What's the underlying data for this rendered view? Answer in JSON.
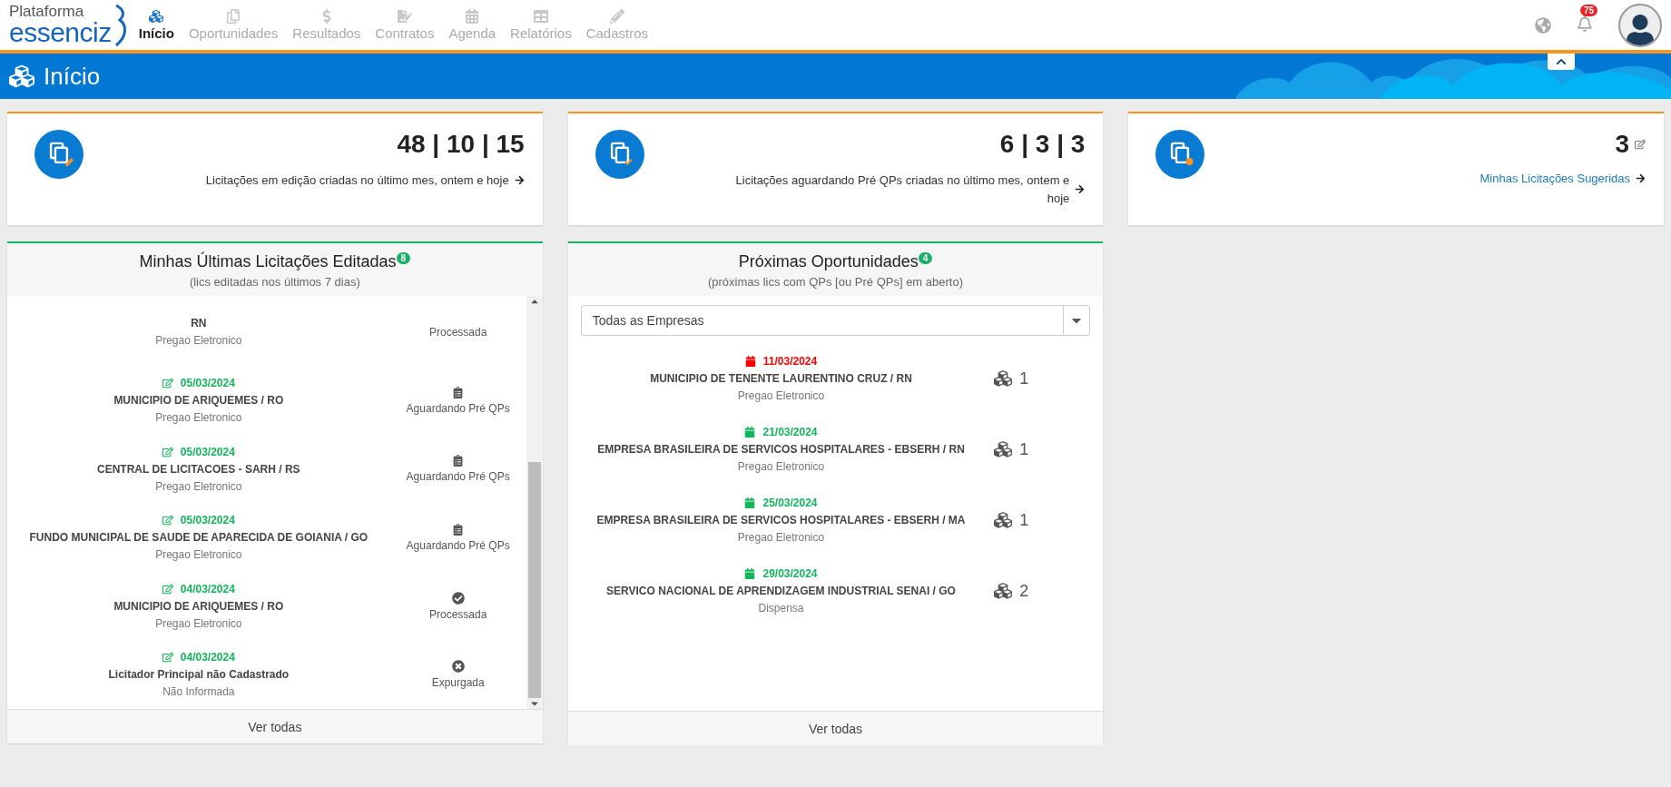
{
  "logo": {
    "top": "Plataforma",
    "bottom": "essenciz"
  },
  "nav": [
    {
      "label": "Início",
      "kind": "cubes",
      "selected": true
    },
    {
      "label": "Oportunidades",
      "kind": "copy",
      "selected": false
    },
    {
      "label": "Resultados",
      "kind": "dollar",
      "selected": false
    },
    {
      "label": "Contratos",
      "kind": "contract",
      "selected": false
    },
    {
      "label": "Agenda",
      "kind": "calendar",
      "selected": false
    },
    {
      "label": "Relatórios",
      "kind": "table",
      "selected": false
    },
    {
      "label": "Cadastros",
      "kind": "pencil",
      "selected": false
    }
  ],
  "notifications": {
    "count": "75"
  },
  "page_title": "Início",
  "stats": [
    {
      "kind": "edit",
      "value": "48 | 10 | 15",
      "text": "Licitações em edição criadas no último mes, ontem e hoje"
    },
    {
      "kind": "check",
      "value": "6 | 3 | 3",
      "text": "Licitações aguardando Pré QPs criadas no último mes, ontem e hoje"
    },
    {
      "kind": "bulb",
      "value": "3",
      "link": "Minhas Licitações Sugeridas"
    }
  ],
  "recent": {
    "title": "Minhas Últimas Licitações Editadas",
    "count": "8",
    "subtitle": "(lics editadas nos últimos 7 dias)",
    "items": [
      {
        "org": "RN",
        "modality": "Pregao Eletronico",
        "status": "Processada",
        "kind": "none"
      },
      {
        "date": "05/03/2024",
        "org": "MUNICIPIO DE ARIQUEMES / RO",
        "modality": "Pregao Eletronico",
        "status": "Aguardando Pré QPs",
        "kind": "pending"
      },
      {
        "date": "05/03/2024",
        "org": "CENTRAL DE LICITACOES - SARH / RS",
        "modality": "Pregao Eletronico",
        "status": "Aguardando Pré QPs",
        "kind": "pending"
      },
      {
        "date": "05/03/2024",
        "org": "FUNDO MUNICIPAL DE SAUDE DE APARECIDA DE GOIANIA / GO",
        "modality": "Pregao Eletronico",
        "status": "Aguardando Pré QPs",
        "kind": "pending"
      },
      {
        "date": "04/03/2024",
        "org": "MUNICIPIO DE ARIQUEMES / RO",
        "modality": "Pregao Eletronico",
        "status": "Processada",
        "kind": "processed"
      },
      {
        "date": "04/03/2024",
        "org": "Licitador Principal não Cadastrado",
        "modality": "Não Informada",
        "status": "Expurgada",
        "kind": "purged"
      }
    ],
    "footer": "Ver todas"
  },
  "upcoming": {
    "title": "Próximas Oportunidades",
    "count": "4",
    "subtitle": "(próximas lics com QPs [ou Pré QPs] em aberto)",
    "filter": "Todas as Empresas",
    "items": [
      {
        "date": "11/03/2024",
        "color": "#ff0000",
        "org": "MUNICIPIO DE TENENTE LAURENTINO CRUZ / RN",
        "modality": "Pregao Eletronico",
        "qty": "1"
      },
      {
        "date": "21/03/2024",
        "color": "#11b75a",
        "org": "EMPRESA BRASILEIRA DE SERVICOS HOSPITALARES - EBSERH / RN",
        "modality": "Pregao Eletronico",
        "qty": "1"
      },
      {
        "date": "25/03/2024",
        "color": "#11b75a",
        "org": "EMPRESA BRASILEIRA DE SERVICOS HOSPITALARES - EBSERH / MA",
        "modality": "Pregao Eletronico",
        "qty": "1"
      },
      {
        "date": "29/03/2024",
        "color": "#11b75a",
        "org": "SERVICO NACIONAL DE APRENDIZAGEM INDUSTRIAL SENAI / GO",
        "modality": "Dispensa",
        "qty": "2"
      }
    ],
    "footer": "Ver todas"
  }
}
